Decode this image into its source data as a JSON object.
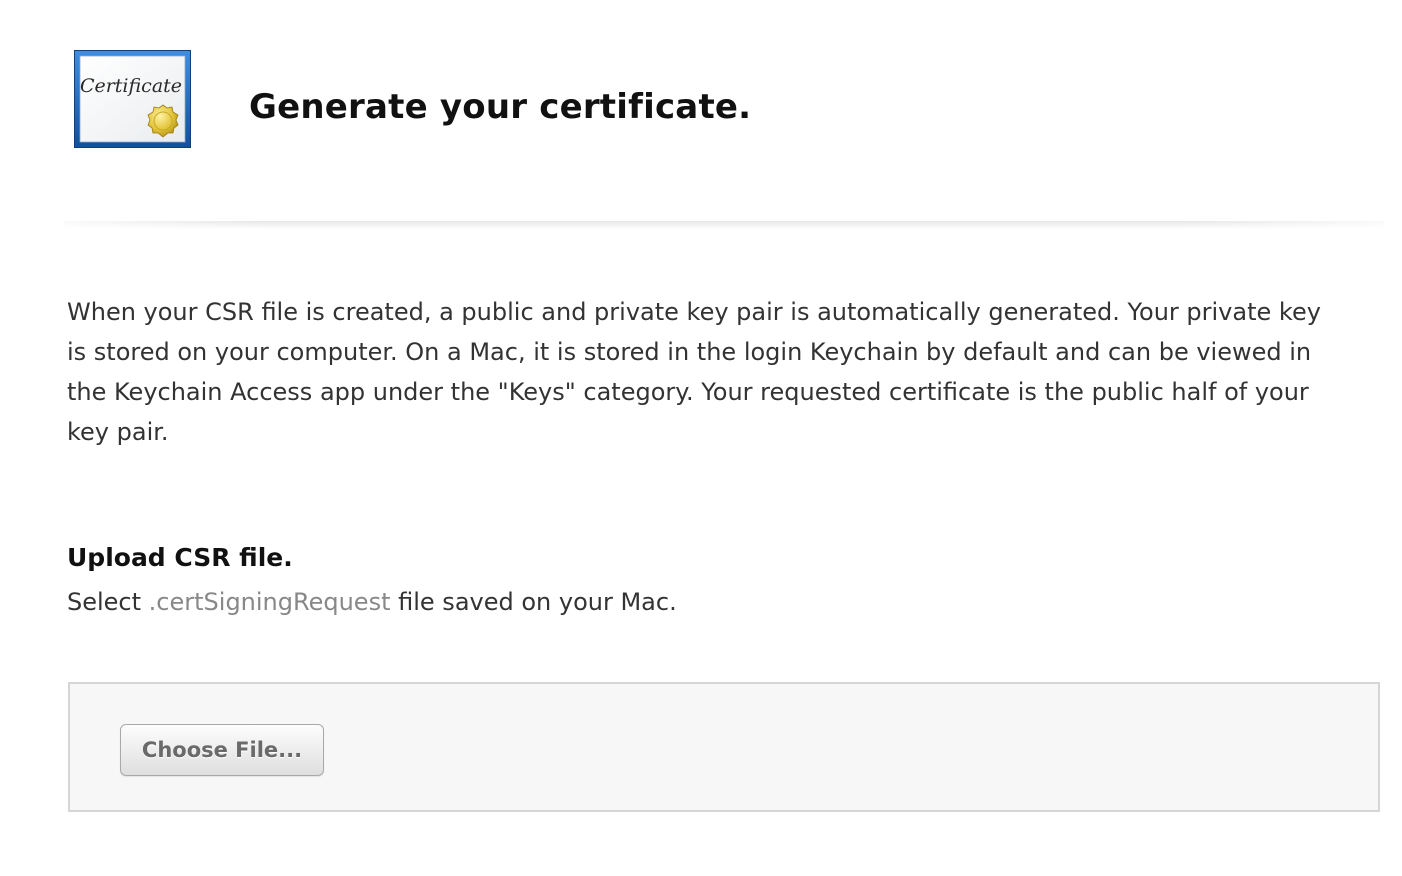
{
  "header": {
    "icon": "certificate-icon",
    "icon_text": "Certificate",
    "title": "Generate your certificate."
  },
  "description": "When your CSR file is created, a public and private key pair is automatically generated. Your private key is stored on your computer. On a Mac, it is stored in the login Keychain by default and can be viewed in the Keychain Access app under the \"Keys\" category. Your requested certificate is the public half of your key pair.",
  "upload": {
    "heading": "Upload CSR file.",
    "instruction_prefix": "Select ",
    "file_extension": ".certSigningRequest",
    "instruction_suffix": " file saved on your Mac.",
    "button_label": "Choose File..."
  },
  "colors": {
    "icon_border": "#1a63b8",
    "seal": "#e2c53a",
    "file_extension_text": "#888888"
  }
}
